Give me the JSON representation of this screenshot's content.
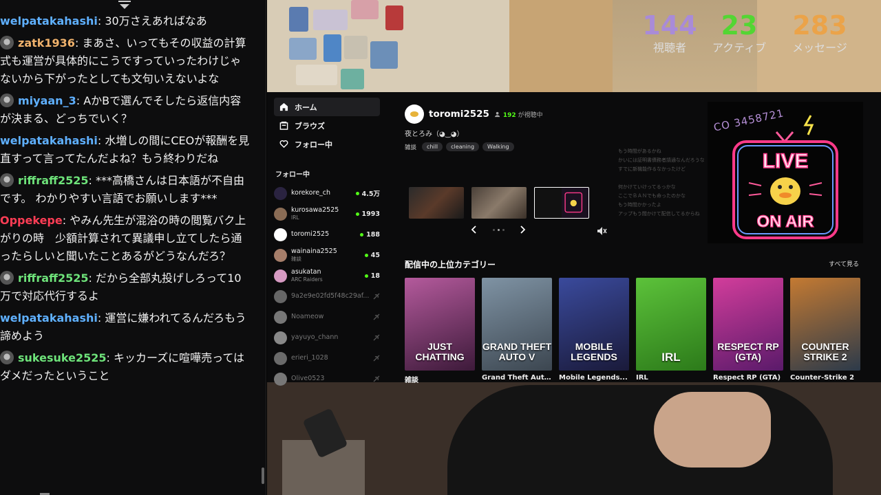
{
  "chat": {
    "messages": [
      {
        "user": "welpatakahashi",
        "color": "#5fb0ff",
        "avatar": false,
        "text": "30万さえあればなあ"
      },
      {
        "user": "zatk1936",
        "color": "#f0b26c",
        "avatar": true,
        "text": "まあさ、いってもその収益の計算式も運営が具体的にこうですっていったわけじゃないから下がったとしても文句いえないよな"
      },
      {
        "user": "miyaan_3",
        "color": "#5fb0ff",
        "avatar": true,
        "text": "AかBで選んでそしたら返信内容が決まる、どっちでいく？"
      },
      {
        "user": "welpatakahashi",
        "color": "#5fb0ff",
        "avatar": false,
        "text": "水増しの間にCEOが報酬を見直すって言ってたんだよね？もう終わりだね"
      },
      {
        "user": "riffraff2525",
        "color": "#6ee37a",
        "avatar": true,
        "text": "***高橋さんは日本語が不自由です。 わかりやすい言語でお願いします***"
      },
      {
        "user": "Oppekepe",
        "color": "#ff3d55",
        "avatar": false,
        "text": "やみん先生が混浴の時の閲覧バク上がりの時　少額計算されて異議申し立てしたら通ったらしいと聞いたことあるがどうなんだろ？"
      },
      {
        "user": "riffraff2525",
        "color": "#6ee37a",
        "avatar": true,
        "text": "だから全部丸投げしろって10万で対応代行するよ"
      },
      {
        "user": "welpatakahashi",
        "color": "#5fb0ff",
        "avatar": false,
        "text": "運営に嫌われてるんだろもう諦めよう"
      },
      {
        "user": "sukesuke2525",
        "color": "#6ee37a",
        "avatar": true,
        "text": "キッカーズに喧嘩売ってはダメだったということ"
      }
    ]
  },
  "stats": {
    "viewers": {
      "value": "144",
      "label": "視聴者",
      "color": "#a98bd8"
    },
    "active": {
      "value": "23",
      "label": "アクティブ",
      "color": "#53d633"
    },
    "messages": {
      "value": "283",
      "label": "メッセージ",
      "color": "#eba349"
    }
  },
  "sidebar": {
    "nav": [
      {
        "label": "ホーム",
        "icon": "home-icon"
      },
      {
        "label": "ブラウズ",
        "icon": "browse-icon"
      },
      {
        "label": "フォロー中",
        "icon": "heart-icon"
      }
    ],
    "following_heading": "フォロー中",
    "following": [
      {
        "name": "korekore_ch",
        "sub": "",
        "count": "4.5万",
        "live": true,
        "color": "#2a2340"
      },
      {
        "name": "kurosawa2525",
        "sub": "IRL",
        "count": "1993",
        "live": true,
        "color": "#8a6c55"
      },
      {
        "name": "toromi2525",
        "sub": "",
        "count": "188",
        "live": true,
        "color": "#ffffff"
      },
      {
        "name": "wainaina2525",
        "sub": "雑談",
        "count": "45",
        "live": true,
        "color": "#a67e6a"
      },
      {
        "name": "asukatan",
        "sub": "ARC Raiders",
        "count": "18",
        "live": true,
        "color": "#d69ac2"
      },
      {
        "name": "9a2e9e02fd5f48c29af...",
        "sub": "",
        "count": "",
        "live": false,
        "color": "#666"
      },
      {
        "name": "Noameow",
        "sub": "",
        "count": "",
        "live": false,
        "color": "#777"
      },
      {
        "name": "yayuyo_chann",
        "sub": "",
        "count": "",
        "live": false,
        "color": "#888"
      },
      {
        "name": "erieri_1028",
        "sub": "",
        "count": "",
        "live": false,
        "color": "#6a6a6a"
      },
      {
        "name": "Olive0523",
        "sub": "",
        "count": "",
        "live": false,
        "color": "#777"
      }
    ]
  },
  "featured": {
    "channel": "toromi2525",
    "viewers": "192",
    "viewers_suffix": "が視聴中",
    "title": "夜とろみ（◕‿◕）",
    "category": "雑談",
    "tags": [
      "chill",
      "cleaning",
      "Walking"
    ],
    "ghost_lines": [
      "もう時間があるかね",
      "かいには証明書債務者請通なんだろうな",
      "すでに新機能作るなかったけど",
      "",
      "何かけていけってるっかな",
      "ここでＢＡＮでも命ったのかな",
      "もう時間かかったよ",
      "アップもう間かけて配信してるからね"
    ],
    "neon_code": "CO 3458721"
  },
  "categories": {
    "heading": "配信中の上位カテゴリー",
    "see_all": "すべて見る",
    "items": [
      {
        "label": "雑談",
        "art": "JUST CHATTING",
        "color1": "#b45a9c",
        "color2": "#3d1a3a"
      },
      {
        "label": "Grand Theft Aut...",
        "art": "GRAND THEFT AUTO V",
        "color1": "#7f93a4",
        "color2": "#3c4650"
      },
      {
        "label": "Mobile Legends...",
        "art": "MOBILE LEGENDS",
        "color1": "#3a4a9c",
        "color2": "#1a1a3a"
      },
      {
        "label": "IRL",
        "art": "IRL",
        "color1": "#5cc23a",
        "color2": "#2c7a1a"
      },
      {
        "label": "Respect RP (GTA)",
        "art": "RESPECT RP (GTA)",
        "color1": "#d23d9b",
        "color2": "#5a1a6a"
      },
      {
        "label": "Counter-Strike 2",
        "art": "COUNTER STRIKE 2",
        "color1": "#c47a32",
        "color2": "#2c3a4a"
      }
    ]
  }
}
